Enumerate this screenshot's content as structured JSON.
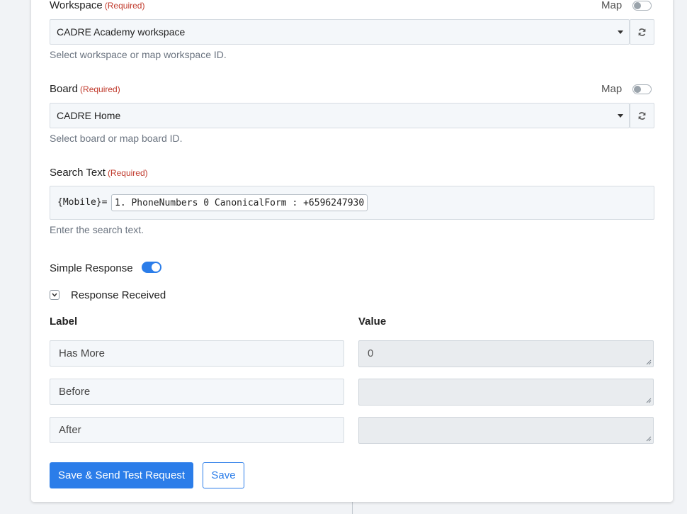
{
  "workspace": {
    "label": "Workspace",
    "required": "(Required)",
    "map_label": "Map",
    "value": "CADRE Academy workspace",
    "help": "Select workspace or map workspace ID."
  },
  "board": {
    "label": "Board",
    "required": "(Required)",
    "map_label": "Map",
    "value": "CADRE Home",
    "help": "Select board or map board ID."
  },
  "search_text": {
    "label": "Search Text",
    "required": "(Required)",
    "prefix": "{Mobile}=",
    "token": "1. PhoneNumbers 0 CanonicalForm : +6596247930",
    "help": "Enter the search text."
  },
  "simple_response": {
    "label": "Simple Response",
    "enabled": true
  },
  "response_received": {
    "label": "Response Received",
    "expanded": true
  },
  "response_table": {
    "label_header": "Label",
    "value_header": "Value",
    "rows": [
      {
        "label": "Has More",
        "value": "0"
      },
      {
        "label": "Before",
        "value": ""
      },
      {
        "label": "After",
        "value": ""
      }
    ]
  },
  "buttons": {
    "save_send": "Save & Send Test Request",
    "save": "Save"
  },
  "colors": {
    "accent": "#2b7de9",
    "required": "#c0392b"
  },
  "icons": {
    "refresh": "refresh-icon",
    "chevron": "chevron-down-icon"
  }
}
